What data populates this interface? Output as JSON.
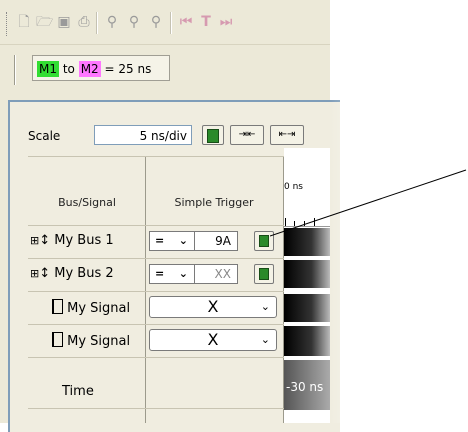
{
  "toolbar": {
    "icons": [
      "new-file-icon",
      "open-folder-icon",
      "save-icon",
      "print-icon",
      "find-icon",
      "find-next-icon",
      "find-prev-icon",
      "go-start-icon",
      "trigger-icon",
      "next-icon"
    ]
  },
  "marker": {
    "m1": "M1",
    "to": "to",
    "m2": "M2",
    "equals": "= 25 ns"
  },
  "scale": {
    "label": "Scale",
    "value": "5 ns/div"
  },
  "table": {
    "col1_header": "Bus/Signal",
    "col2_header": "Simple Trigger",
    "time_label": "Time",
    "rows": [
      {
        "name": "My Bus 1",
        "op": "=",
        "value": "9A"
      },
      {
        "name": "My Bus 2",
        "op": "=",
        "value": "XX"
      },
      {
        "name": "My Signal",
        "trigger": "X"
      },
      {
        "name": "My Signal",
        "trigger": "X"
      }
    ]
  },
  "waveform": {
    "top_time": "0 ns",
    "bottom_time": "-30 ns"
  },
  "colors": {
    "m1": "#33dd33",
    "m2": "#ff77ff"
  }
}
